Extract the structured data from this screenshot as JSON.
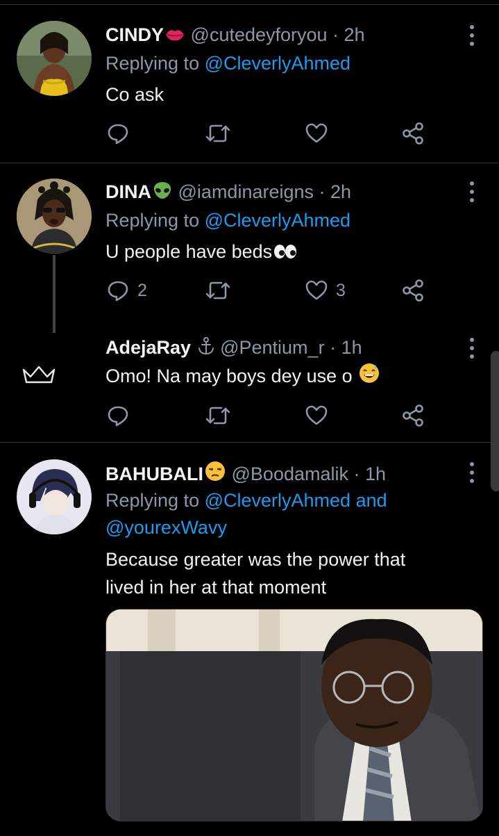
{
  "tweets": [
    {
      "name": "CINDY",
      "handle": "@cutedeyforyou",
      "sep": " · ",
      "time": "2h",
      "replying_prefix": "Replying to ",
      "replying_to": "@CleverlyAhmed",
      "text": "Co ask",
      "replies": "",
      "retweets": "",
      "likes": ""
    },
    {
      "name": "DINA",
      "handle": "@iamdinareigns",
      "sep": " · ",
      "time": "2h",
      "replying_prefix": "Replying to ",
      "replying_to": "@CleverlyAhmed",
      "text": "U people have beds",
      "replies": "2",
      "retweets": "",
      "likes": "3"
    },
    {
      "name": "AdejaRay",
      "handle": "@Pentium_r",
      "sep": " · ",
      "time": "1h",
      "text": "Omo! Na may boys dey use o",
      "replies": "",
      "retweets": "",
      "likes": ""
    },
    {
      "name": "BAHUBALI",
      "handle": "@Boodamalik",
      "sep": " · ",
      "time": "1h",
      "replying_prefix": "Replying to ",
      "replying_to": "@CleverlyAhmed and",
      "replying_to_2": "@yourexWavy",
      "text_line1": "Because greater was the power that",
      "text_line2": "lived in her at that moment"
    }
  ],
  "colors": {
    "background": "#000000",
    "link": "#1d9bf0",
    "muted": "#8b98a5",
    "divider": "#2f3336"
  },
  "icons": [
    "reply-icon",
    "retweet-icon",
    "like-icon",
    "share-icon",
    "more-icon",
    "crown-icon",
    "anchor-icon",
    "kiss-lips-emoji",
    "alien-emoji",
    "eyes-emoji",
    "sweat-smile-emoji",
    "unamused-emoji"
  ]
}
